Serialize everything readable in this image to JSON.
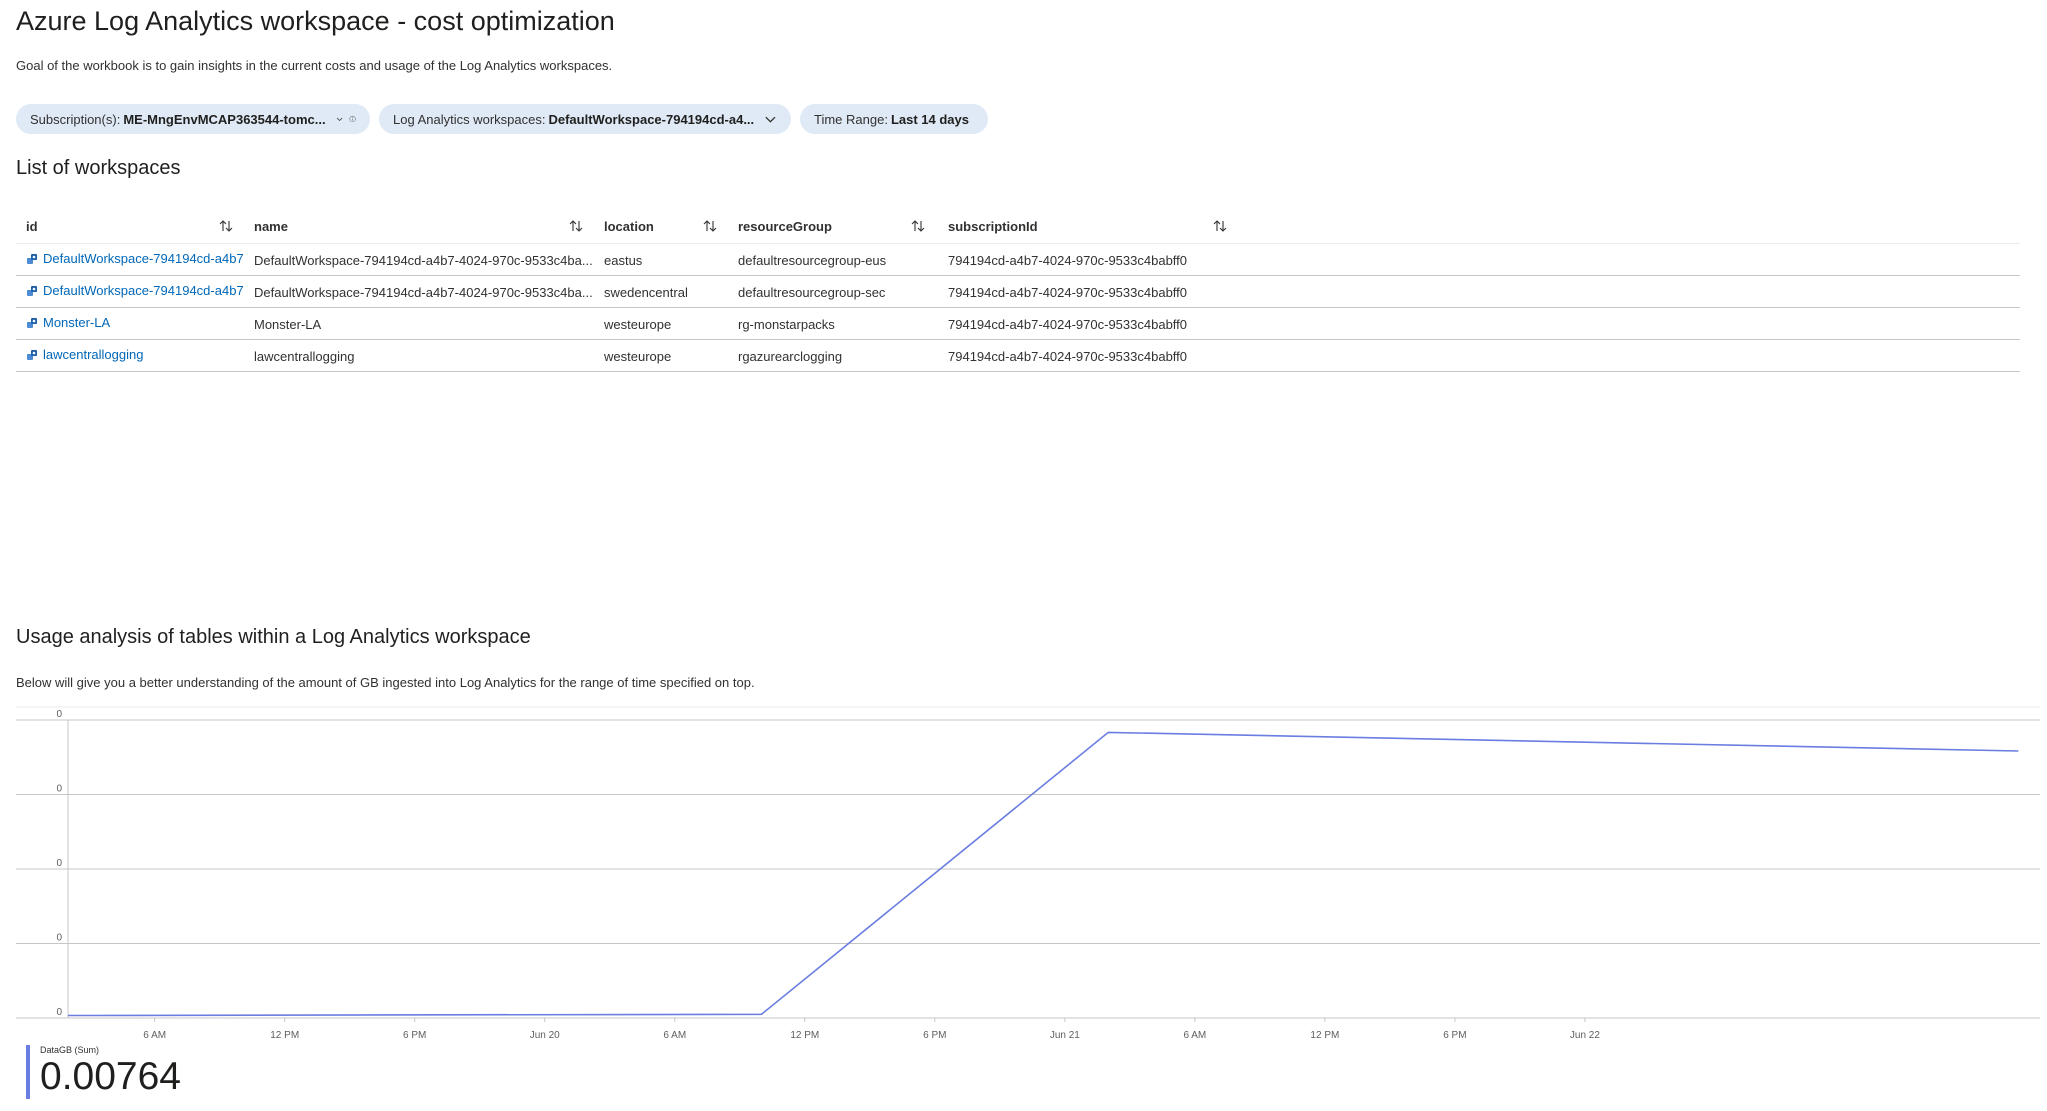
{
  "header": {
    "title": "Azure Log Analytics workspace - cost optimization",
    "description": "Goal of the workbook is to gain insights in the current costs and usage of the Log Analytics workspaces."
  },
  "parameters": {
    "subscription": {
      "label": "Subscription(s):",
      "value": "ME-MngEnvMCAP363544-tomc..."
    },
    "workspaces": {
      "label": "Log Analytics workspaces:",
      "value": "DefaultWorkspace-794194cd-a4..."
    },
    "time_range": {
      "label": "Time Range:",
      "value": "Last 14 days"
    }
  },
  "workspaces_section": {
    "title": "List of workspaces",
    "columns": [
      "id",
      "name",
      "location",
      "resourceGroup",
      "subscriptionId"
    ],
    "rows": [
      {
        "id": "DefaultWorkspace-794194cd-a4b7",
        "name": "DefaultWorkspace-794194cd-a4b7-4024-970c-9533c4ba...",
        "location": "eastus",
        "resourceGroup": "defaultresourcegroup-eus",
        "subscriptionId": "794194cd-a4b7-4024-970c-9533c4babff0"
      },
      {
        "id": "DefaultWorkspace-794194cd-a4b7",
        "name": "DefaultWorkspace-794194cd-a4b7-4024-970c-9533c4ba...",
        "location": "swedencentral",
        "resourceGroup": "defaultresourcegroup-sec",
        "subscriptionId": "794194cd-a4b7-4024-970c-9533c4babff0"
      },
      {
        "id": "Monster-LA",
        "name": "Monster-LA",
        "location": "westeurope",
        "resourceGroup": "rg-monstarpacks",
        "subscriptionId": "794194cd-a4b7-4024-970c-9533c4babff0"
      },
      {
        "id": "lawcentrallogging",
        "name": "lawcentrallogging",
        "location": "westeurope",
        "resourceGroup": "rgazurearclogging",
        "subscriptionId": "794194cd-a4b7-4024-970c-9533c4babff0"
      }
    ]
  },
  "usage_section": {
    "title": "Usage analysis of tables within a Log Analytics workspace",
    "description": "Below will give you a better understanding of the amount of GB ingested into Log Analytics for the range of time specified on top."
  },
  "chart_data": {
    "type": "line",
    "x_ticks": [
      "6 AM",
      "12 PM",
      "6 PM",
      "Jun 20",
      "6 AM",
      "12 PM",
      "6 PM",
      "Jun 21",
      "6 AM",
      "12 PM",
      "6 PM",
      "Jun 22"
    ],
    "y_ticks": [
      "0",
      "0",
      "0",
      "0",
      "0"
    ],
    "x_range": [
      "Jun 19 2:00 AM",
      "Jun 22 9:00 PM"
    ],
    "ylim": [
      0,
      0.0024
    ],
    "grid": true,
    "series": [
      {
        "name": "DataGB (Sum)",
        "color": "#6a7de0",
        "points": [
          {
            "x": "Jun 19 2:00 AM",
            "y": 2e-05
          },
          {
            "x": "Jun 20 10:00 AM",
            "y": 3e-05
          },
          {
            "x": "Jun 21 2:00 AM",
            "y": 0.0023
          },
          {
            "x": "Jun 22 8:00 PM",
            "y": 0.00215
          }
        ]
      }
    ],
    "legend": {
      "position": "bottom-left",
      "items": [
        {
          "name": "DataGB (Sum)",
          "value": "0.00764",
          "color": "#6a7de0"
        }
      ]
    }
  }
}
